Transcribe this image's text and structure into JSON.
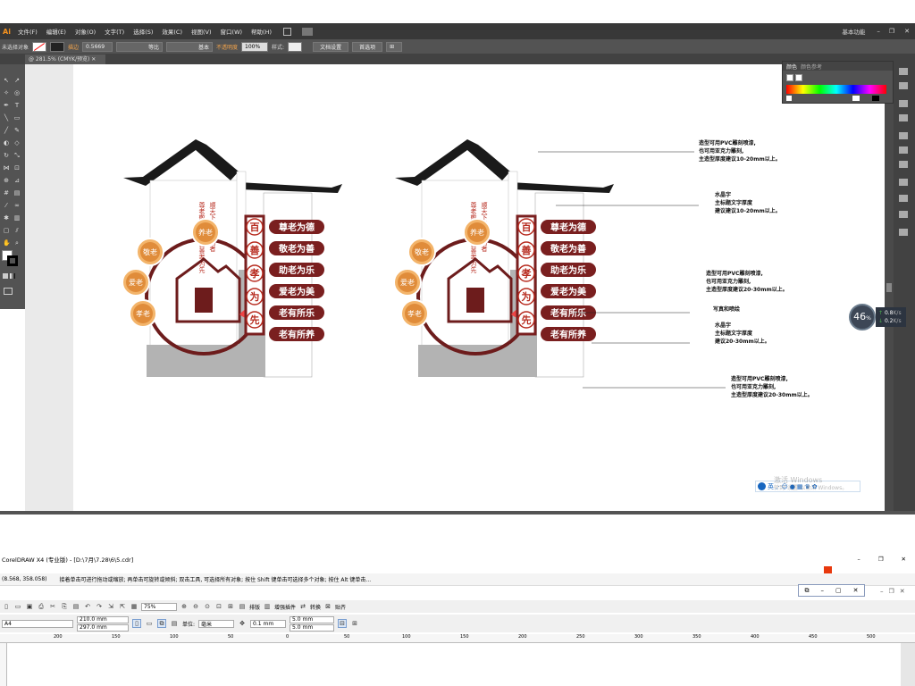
{
  "ai": {
    "logo": "Ai",
    "menu": [
      "文件(F)",
      "编辑(E)",
      "对象(O)",
      "文字(T)",
      "选择(S)",
      "效果(C)",
      "视图(V)",
      "窗口(W)",
      "帮助(H)"
    ],
    "workspace_label": "基本功能",
    "control": {
      "selection_label": "未选择对象",
      "stroke_label": "描边",
      "stroke_value": "0.5669",
      "stroke_profile": "等比",
      "brush": "基本",
      "opacity_label": "不透明度",
      "opacity_value": "100%",
      "style_label": "样式:",
      "doc_setup_button": "文档设置",
      "prefs_button": "首选项"
    },
    "tab_label": "@ 281.5% (CMYK/预览)",
    "color_panel": {
      "tab1": "颜色",
      "tab2": "颜色参考"
    },
    "speed": {
      "percent": "46",
      "unit": "%",
      "up": "0.8",
      "up_unit": "K/s",
      "down": "0.2",
      "down_unit": "K/s"
    }
  },
  "design": {
    "left_vertical_text": "尊老敬老为人 百善孝为先",
    "left_vertical_text2": "顺天下风不可为者",
    "banner_chars": [
      "百",
      "善",
      "孝",
      "为",
      "先"
    ],
    "slogans": [
      "尊老为德",
      "敬老为善",
      "助老为乐",
      "爱老为美",
      "老有所乐",
      "老有所养"
    ],
    "circles": [
      "养老",
      "敬老",
      "爱老",
      "孝老"
    ]
  },
  "annotations": [
    {
      "lines": [
        "造型可用PVC雕刻喷漆,",
        "也可用亚克力雕刻,",
        "主造型厚度建议10-20mm以上。"
      ]
    },
    {
      "lines": [
        "水晶字",
        "主标题文字厚度",
        "建议建议10-20mm以上。"
      ]
    },
    {
      "lines": [
        "造型可用PVC雕刻喷漆,",
        "也可用亚克力雕刻,",
        "主造型厚度建议20-30mm以上。"
      ]
    },
    {
      "lines": [
        "写真和喷绘"
      ]
    },
    {
      "lines": [
        "水晶字",
        "主标题文字厚度",
        "建议20-30mm以上。"
      ]
    },
    {
      "lines": [
        "造型可用PVC雕刻喷漆,",
        "也可用亚克力雕刻,",
        "主造型厚度建议20-30mm以上。"
      ]
    }
  ],
  "ime": {
    "lang": "英",
    "activate_line1": "激活 Windows",
    "activate_line2": "转到\"设置\"以激活 Windows。"
  },
  "cd": {
    "title": "CorelDRAW X4 (专业版) - [D:\\7月\\7.28\\6\\5.cdr]",
    "coords": "(8.568, 358.058)",
    "hint": "接着单击可进行拖动或缩放; 再单击可旋转或倾斜; 双击工具, 可选择所有对象; 按住 Shift 键单击可选择多个对象; 按住 Alt 键单击...",
    "zoom": "75%",
    "paper": "A4",
    "width": "210.0 mm",
    "height": "297.0 mm",
    "unit_label": "单位:",
    "unit": "毫米",
    "nudge": "0.1 mm",
    "dup_x": "5.0 mm",
    "dup_y": "5.0 mm",
    "toolbar_labels": [
      "排版",
      "增强插件",
      "转换",
      "贴齐"
    ],
    "ruler_ticks": [
      "200",
      "150",
      "100",
      "50",
      "0",
      "50",
      "100",
      "150",
      "200",
      "250",
      "300",
      "350",
      "400",
      "450",
      "500"
    ]
  }
}
